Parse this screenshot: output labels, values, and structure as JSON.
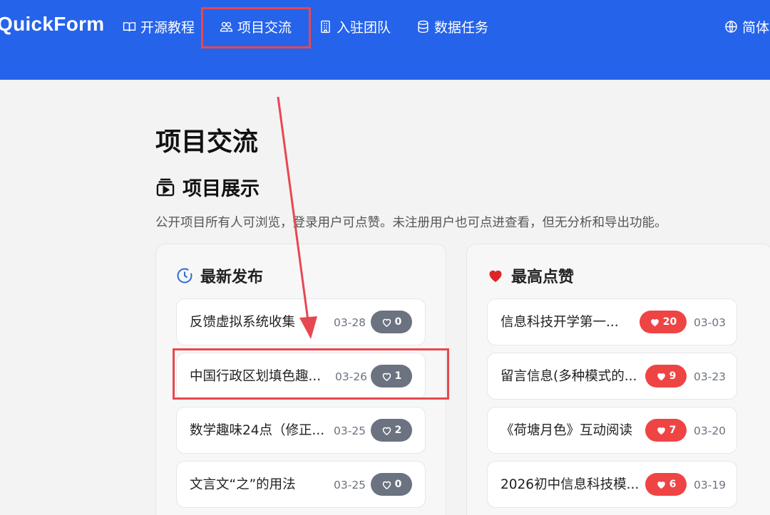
{
  "brand": "QuickForm",
  "nav": {
    "learn": "开源教程",
    "exchange": "项目交流",
    "team": "入驻团队",
    "data": "数据任务",
    "lang": "简体"
  },
  "page": {
    "title": "项目交流",
    "section_title": "项目展示",
    "description": "公开项目所有人可浏览，登录用户可点赞。未注册用户也可点进查看，但无分析和导出功能。"
  },
  "latest": {
    "heading": "最新发布",
    "items": [
      {
        "title": "反馈虚拟系统收集",
        "date": "03-28",
        "likes": "0"
      },
      {
        "title": "中国行政区划填色趣...",
        "date": "03-26",
        "likes": "1"
      },
      {
        "title": "数学趣味24点（修正...",
        "date": "03-25",
        "likes": "2"
      },
      {
        "title": "文言文“之”的用法",
        "date": "03-25",
        "likes": "0"
      }
    ]
  },
  "top": {
    "heading": "最高点赞",
    "items": [
      {
        "title": "信息科技开学第一...",
        "date": "03-03",
        "likes": "20"
      },
      {
        "title": "留言信息(多种模式的...",
        "date": "03-23",
        "likes": "9"
      },
      {
        "title": "《荷塘月色》互动阅读",
        "date": "03-20",
        "likes": "7"
      },
      {
        "title": "2026初中信息科技模...",
        "date": "03-19",
        "likes": "6"
      }
    ]
  },
  "colors": {
    "header": "#2563eb",
    "like_gray": "#6b7280",
    "like_red": "#ef4444",
    "annotation": "#e8474f"
  }
}
